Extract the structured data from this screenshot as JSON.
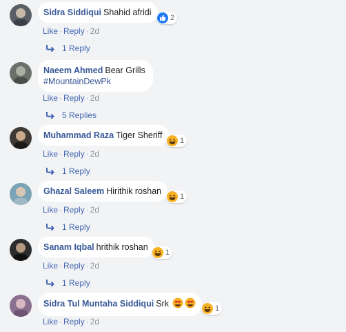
{
  "comments": [
    {
      "author": "Sidra Siddiqui",
      "text": "Shahid afridi",
      "reaction": "like",
      "reaction_count": "2",
      "actions": {
        "like": "Like",
        "reply": "Reply",
        "time": "2d"
      },
      "replies": "1 Reply",
      "avatar_colors": [
        "#5a5f66",
        "#c8b8a8"
      ]
    },
    {
      "author": "Naeem Ahmed",
      "text": "Bear Grills",
      "hashtag": "#MountainDewPk",
      "actions": {
        "like": "Like",
        "reply": "Reply",
        "time": "2d"
      },
      "replies": "5 Replies",
      "avatar_colors": [
        "#6b6f6a",
        "#a9b0a3"
      ]
    },
    {
      "author": "Muhammad Raza",
      "text": "Tiger Sheriff",
      "reaction": "haha",
      "reaction_count": "1",
      "actions": {
        "like": "Like",
        "reply": "Reply",
        "time": "2d"
      },
      "replies": "1 Reply",
      "avatar_colors": [
        "#3f3a36",
        "#c8a98c"
      ]
    },
    {
      "author": "Ghazal Saleem",
      "text": "Hirithik roshan",
      "reaction": "haha",
      "reaction_count": "1",
      "actions": {
        "like": "Like",
        "reply": "Reply",
        "time": "2d"
      },
      "replies": "1 Reply",
      "avatar_colors": [
        "#7aa3b5",
        "#d9c7b6"
      ]
    },
    {
      "author": "Sanam Iqbal",
      "text": "hrithik roshan",
      "reaction": "haha",
      "reaction_count": "1",
      "actions": {
        "like": "Like",
        "reply": "Reply",
        "time": "2d"
      },
      "replies": "1 Reply",
      "avatar_colors": [
        "#2d2d2d",
        "#b59a82"
      ]
    },
    {
      "author": "Sidra Tul Muntaha Siddiqui",
      "text": "Srk",
      "emoji_text": "😍😍",
      "reaction": "haha",
      "reaction_count": "1",
      "actions": {
        "like": "Like",
        "reply": "Reply",
        "time": "2d"
      },
      "avatar_colors": [
        "#8a6f8f",
        "#d8b8c0"
      ]
    }
  ],
  "colors": {
    "background": "#f2f3f5",
    "link": "#4267b2",
    "author": "#385898",
    "meta": "#90949c",
    "like_blue": "#2078f4",
    "haha_yellow": "#f7b125"
  }
}
